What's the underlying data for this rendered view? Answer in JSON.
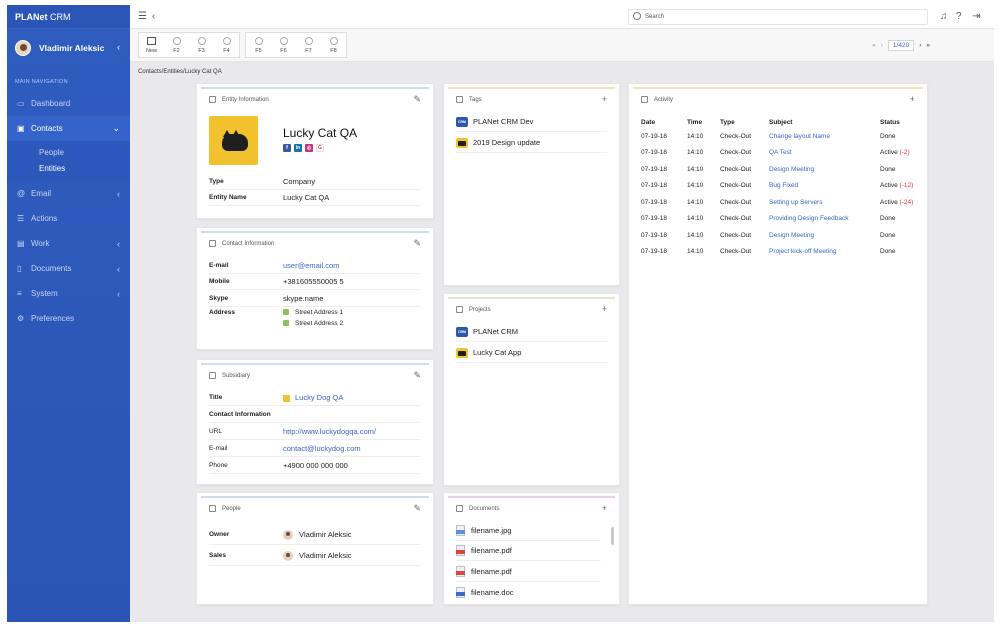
{
  "app": {
    "brand_bold": "PLANet",
    "brand_rest": " CRM"
  },
  "user": {
    "name": "Vladimir Aleksic"
  },
  "nav": {
    "heading": "MAIN NAVIGATION",
    "items": [
      {
        "label": "Dashboard"
      },
      {
        "label": "Contacts"
      },
      {
        "label": "Email"
      },
      {
        "label": "Actions"
      },
      {
        "label": "Work"
      },
      {
        "label": "Documents"
      },
      {
        "label": "System"
      },
      {
        "label": "Preferences"
      }
    ],
    "contacts_sub": [
      {
        "label": "People"
      },
      {
        "label": "Entities"
      }
    ]
  },
  "search": {
    "placeholder": "Search"
  },
  "toolbar": {
    "new": "New",
    "f2": "F2",
    "f3": "F3",
    "f4": "F4",
    "f5": "F5",
    "f6": "F6",
    "f7": "F7",
    "f8": "F8"
  },
  "pager": {
    "page": "1/420"
  },
  "breadcrumb": "Contacts/Entities/Lucky Cat QA",
  "entity": {
    "header": "Entity Information",
    "name": "Lucky Cat QA",
    "type_label": "Type",
    "type_value": "Company",
    "entity_name_label": "Entity Name",
    "entity_name_value": "Lucky Cat QA"
  },
  "contact": {
    "header": "Contact Information",
    "email_label": "E-mail",
    "email": "user@email.com",
    "mobile_label": "Mobile",
    "mobile": "+381605550005 5",
    "skype_label": "Skype",
    "skype": "skype.name",
    "address_label": "Address",
    "address1": "Street Address 1",
    "address2": "Street Address 2"
  },
  "subsidiary": {
    "header": "Subsidiary",
    "title_label": "Title",
    "title": "Lucky Dog QA",
    "contact_info": "Contact Information",
    "url_label": "URL",
    "url": "http://www.luckydogqa.com/",
    "email_label": "E-mail",
    "email": "contact@luckydog.com",
    "phone_label": "Phone",
    "phone": "+4900 000 000 000"
  },
  "people": {
    "header": "People",
    "owner_label": "Owner",
    "owner": "Vladimir Aleksic",
    "sales_label": "Sales",
    "sales": "Vladimir Aleksic"
  },
  "tags": {
    "header": "Tags",
    "items": [
      {
        "label": "PLANet CRM Dev"
      },
      {
        "label": "2019 Design update"
      }
    ]
  },
  "projects": {
    "header": "Projects",
    "items": [
      {
        "label": "PLANet CRM"
      },
      {
        "label": "Lucky Cat App"
      }
    ]
  },
  "documents": {
    "header": "Documents",
    "items": [
      {
        "label": "filename.jpg"
      },
      {
        "label": "filename.pdf"
      },
      {
        "label": "filename.pdf"
      },
      {
        "label": "filename.doc"
      }
    ]
  },
  "activity": {
    "header": "Activity",
    "columns": [
      "Date",
      "Time",
      "Type",
      "Subject",
      "Status"
    ],
    "rows": [
      {
        "date": "07-19-18",
        "time": "14:10",
        "type": "Check-Out",
        "subject": "Change layout Name",
        "status": "Done",
        "delta": ""
      },
      {
        "date": "07-19-18",
        "time": "14:10",
        "type": "Check-Out",
        "subject": "QA Test",
        "status": "Active",
        "delta": "(-2)"
      },
      {
        "date": "07-19-18",
        "time": "14:10",
        "type": "Check-Out",
        "subject": "Design Meeting",
        "status": "Done",
        "delta": ""
      },
      {
        "date": "07-19-18",
        "time": "14:10",
        "type": "Check-Out",
        "subject": "Bug Fixed",
        "status": "Active",
        "delta": "(-12)"
      },
      {
        "date": "07-19-18",
        "time": "14:10",
        "type": "Check-Out",
        "subject": "Setting up Servers",
        "status": "Active",
        "delta": "(-24)"
      },
      {
        "date": "07-19-18",
        "time": "14:10",
        "type": "Check-Out",
        "subject": "Providing Design Feedback",
        "status": "Done",
        "delta": ""
      },
      {
        "date": "07-19-18",
        "time": "14:10",
        "type": "Check-Out",
        "subject": "Design Meeting",
        "status": "Done",
        "delta": ""
      },
      {
        "date": "07-19-18",
        "time": "14:10",
        "type": "Check-Out",
        "subject": "Project kick-off Meeting",
        "status": "Done",
        "delta": ""
      }
    ]
  },
  "colors": {
    "sidebar": "#2f5cbf",
    "link": "#3b63c4",
    "negative": "#dd3333"
  }
}
